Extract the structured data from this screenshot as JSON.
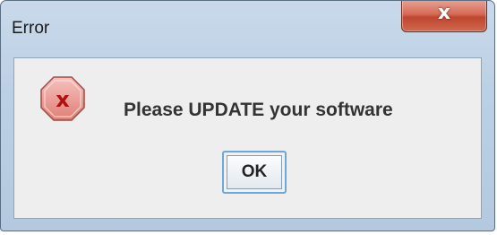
{
  "window": {
    "title": "Error",
    "close_label": "x"
  },
  "dialog": {
    "icon": "error-icon",
    "message": "Please UPDATE your software",
    "ok_label": "OK"
  },
  "colors": {
    "error_icon_fill": "#e8908a",
    "error_icon_glyph": "#b01010",
    "close_button": "#c94a33"
  }
}
